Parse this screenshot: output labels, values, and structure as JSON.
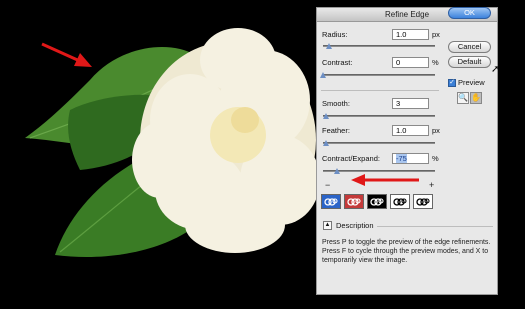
{
  "dialog": {
    "title": "Refine Edge",
    "radius": {
      "label": "Radius:",
      "value": "1.0",
      "unit": "px",
      "slider": 0.05
    },
    "contrast": {
      "label": "Contrast:",
      "value": "0",
      "unit": "%",
      "slider": 0.0
    },
    "smooth": {
      "label": "Smooth:",
      "value": "3",
      "slider": 0.03
    },
    "feather": {
      "label": "Feather:",
      "value": "1.0",
      "unit": "px",
      "slider": 0.03
    },
    "contract_expand": {
      "label": "Contract/Expand:",
      "value": "-75",
      "unit": "%",
      "slider": 0.125,
      "minus": "−",
      "plus": "+"
    },
    "buttons": {
      "ok": "OK",
      "cancel": "Cancel",
      "default": "Default"
    },
    "preview": {
      "label": "Preview",
      "checked": true
    },
    "description": {
      "toggle": "▲",
      "label": "Description",
      "text": "Press P to toggle the preview of the edge refinements. Press F to cycle through the preview modes, and X to temporarily view the image."
    }
  },
  "tools": [
    {
      "icon": "zoom-icon",
      "glyph": "🔍"
    },
    {
      "icon": "hand-icon",
      "glyph": "✋"
    }
  ],
  "preview_modes": [
    {
      "icon": "standard-mode-icon",
      "bg": "#2b64c8",
      "fg": "#ffffff"
    },
    {
      "icon": "quick-mask-mode-icon",
      "bg": "#c43a3a",
      "fg": "#ffffff"
    },
    {
      "icon": "on-black-mode-icon",
      "bg": "#000000",
      "fg": "#ffffff"
    },
    {
      "icon": "on-white-mode-icon",
      "bg": "#ffffff",
      "fg": "#000000"
    },
    {
      "icon": "mask-mode-icon",
      "bg": "#ffffff",
      "fg": "#000000"
    }
  ],
  "colors": {
    "annotation_arrow": "#e01818",
    "leaf": "#3f7d2a",
    "flower": "#f7f4e6"
  }
}
